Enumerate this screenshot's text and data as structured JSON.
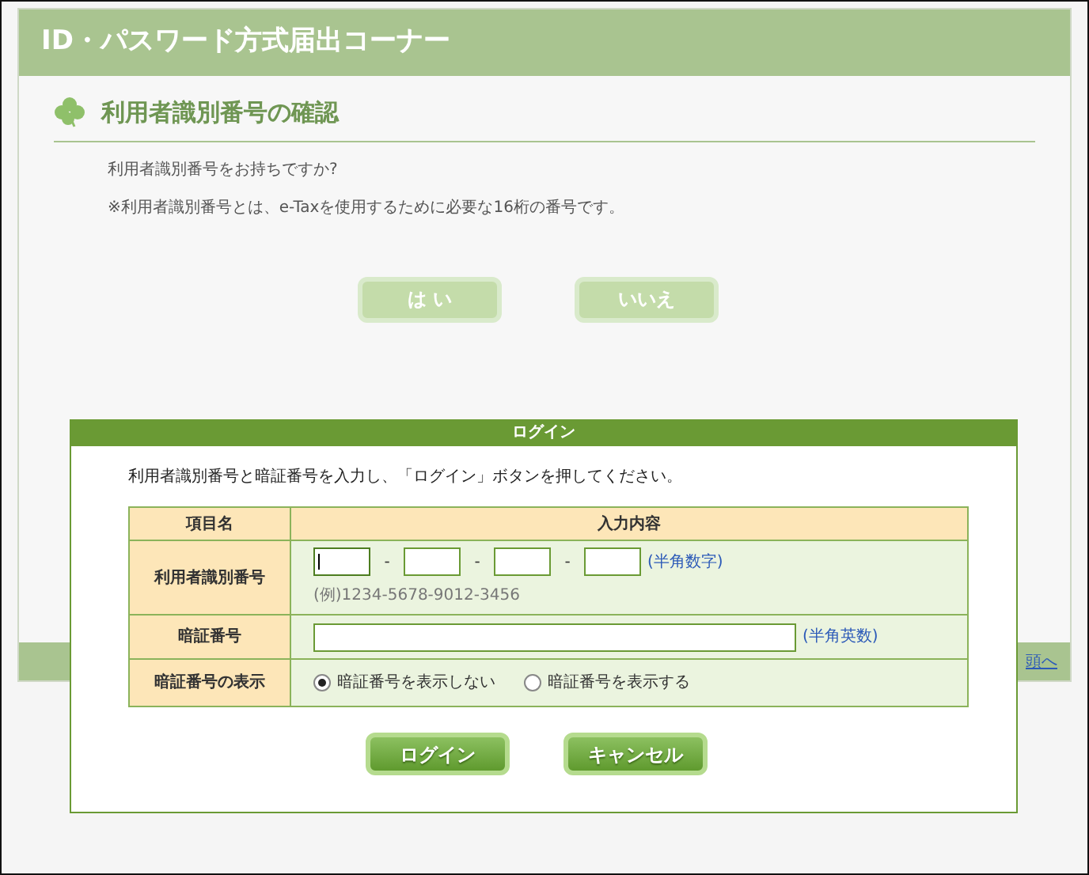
{
  "window": {
    "title": "ID・パスワード方式届出コーナー"
  },
  "section": {
    "heading": "利用者識別番号の確認",
    "lines": [
      "利用者識別番号をお持ちですか?",
      "※利用者識別番号とは、e-Taxを使用するために必要な16桁の番号です。"
    ]
  },
  "choice_buttons": [
    {
      "label": "は い"
    },
    {
      "label": "いいえ"
    }
  ],
  "footer": {
    "link": "頭へ"
  },
  "dialog": {
    "title": "ログイン",
    "instruction": "利用者識別番号と暗証番号を入力し、「ログイン」ボタンを押してください。",
    "table": {
      "columns": [
        "項目名",
        "入力内容"
      ],
      "rows": [
        {
          "kind": "segmented",
          "label": "利用者識別番号",
          "segments": [
            {
              "focused": true
            },
            {
              "focused": false
            },
            {
              "focused": false
            },
            {
              "focused": false
            }
          ],
          "separators": [
            "-",
            "-",
            "-"
          ],
          "hint": "(半角数字)",
          "example": "(例)1234-5678-9012-3456"
        },
        {
          "kind": "password",
          "label": "暗証番号",
          "hint": "(半角英数)"
        },
        {
          "kind": "radio",
          "label": "暗証番号の表示",
          "options": [
            {
              "label": "暗証番号を表示しない",
              "selected": true
            },
            {
              "label": "暗証番号を表示する",
              "selected": false
            }
          ]
        }
      ]
    },
    "buttons": [
      {
        "label": "ログイン"
      },
      {
        "label": "キャンセル"
      }
    ]
  }
}
